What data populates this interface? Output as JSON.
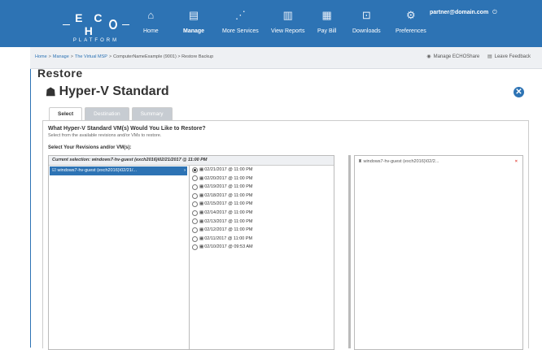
{
  "app": {
    "logo_main_left": "E C H",
    "logo_main_right": "",
    "logo_sub": "PLATFORM",
    "user_email": "partner@domain.com",
    "power_icon": "⏻"
  },
  "nav": [
    {
      "label": "Home",
      "icon": "home-icon",
      "glyph": "⌂"
    },
    {
      "label": "Manage",
      "icon": "manage-icon",
      "glyph": "▤"
    },
    {
      "label": "More Services",
      "icon": "services-icon",
      "glyph": "⋰"
    },
    {
      "label": "View Reports",
      "icon": "reports-icon",
      "glyph": "▥"
    },
    {
      "label": "Pay Bill",
      "icon": "bill-icon",
      "glyph": "▦"
    },
    {
      "label": "Downloads",
      "icon": "downloads-icon",
      "glyph": "⊡"
    },
    {
      "label": "Preferences",
      "icon": "preferences-icon",
      "glyph": "⚙"
    }
  ],
  "breadcrumb": {
    "items": [
      "Home",
      "Manage",
      "The Virtual MSP"
    ],
    "current": "ComputerNameExample (9001) > Restore Backup",
    "manage_share": "Manage ECHOShare",
    "feedback": "Leave Feedback"
  },
  "page": {
    "title": "Restore",
    "panel_title": "Hyper-V Standard",
    "close_glyph": "✕"
  },
  "tabs": [
    {
      "label": "Select",
      "active": true
    },
    {
      "label": "Destination",
      "active": false
    },
    {
      "label": "Summary",
      "active": false
    }
  ],
  "selection": {
    "question": "What Hyper-V Standard VM(s) Would You Like to Restore?",
    "subtext": "Select from the available revisions and/or VMs to restore.",
    "label": "Select Your Revisions and/or VM(s):",
    "current": "Current selection: windows7-hv-guest (exch2016)\\02/21/2017 @ 11:00 PM",
    "vm_row": "windows7-hv-guest (exch2016)\\02/21/...",
    "vm_arrow": "›",
    "revisions": [
      {
        "label": "02/21/2017 @ 11:00 PM",
        "selected": true
      },
      {
        "label": "02/20/2017 @ 11:00 PM",
        "selected": false
      },
      {
        "label": "02/19/2017 @ 11:00 PM",
        "selected": false
      },
      {
        "label": "02/18/2017 @ 11:00 PM",
        "selected": false
      },
      {
        "label": "02/15/2017 @ 11:00 PM",
        "selected": false
      },
      {
        "label": "02/14/2017 @ 11:00 PM",
        "selected": false
      },
      {
        "label": "02/13/2017 @ 11:00 PM",
        "selected": false
      },
      {
        "label": "02/12/2017 @ 11:00 PM",
        "selected": false
      },
      {
        "label": "02/11/2017 @ 11:00 PM",
        "selected": false
      },
      {
        "label": "02/10/2017 @ 09:53 AM",
        "selected": false
      }
    ],
    "selected_item": "windows7-hv-guest (exch2016)\\02/2...",
    "remove_glyph": "×"
  },
  "colors": {
    "brand": "#2d73b4",
    "danger": "#e03c31"
  }
}
